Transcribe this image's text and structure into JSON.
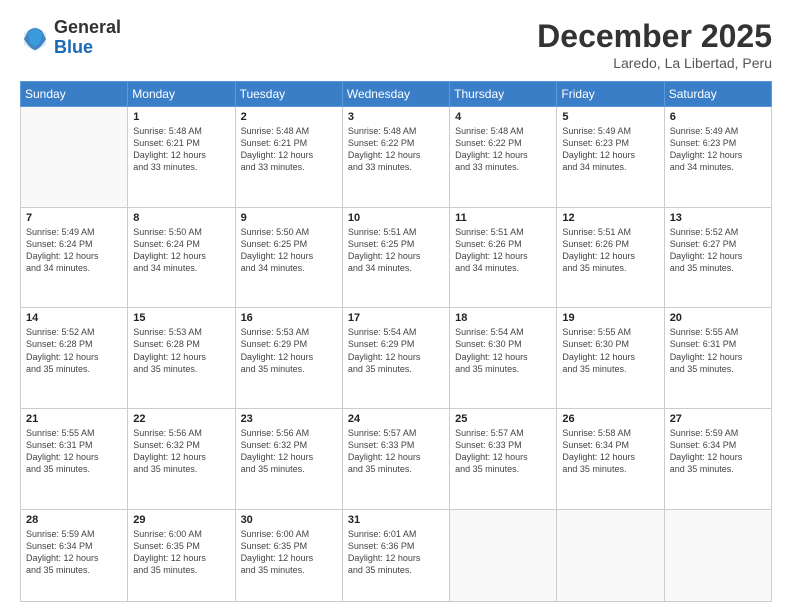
{
  "header": {
    "logo_general": "General",
    "logo_blue": "Blue",
    "month_title": "December 2025",
    "location": "Laredo, La Libertad, Peru"
  },
  "days_of_week": [
    "Sunday",
    "Monday",
    "Tuesday",
    "Wednesday",
    "Thursday",
    "Friday",
    "Saturday"
  ],
  "weeks": [
    [
      {
        "day": "",
        "info": ""
      },
      {
        "day": "1",
        "info": "Sunrise: 5:48 AM\nSunset: 6:21 PM\nDaylight: 12 hours\nand 33 minutes."
      },
      {
        "day": "2",
        "info": "Sunrise: 5:48 AM\nSunset: 6:21 PM\nDaylight: 12 hours\nand 33 minutes."
      },
      {
        "day": "3",
        "info": "Sunrise: 5:48 AM\nSunset: 6:22 PM\nDaylight: 12 hours\nand 33 minutes."
      },
      {
        "day": "4",
        "info": "Sunrise: 5:48 AM\nSunset: 6:22 PM\nDaylight: 12 hours\nand 33 minutes."
      },
      {
        "day": "5",
        "info": "Sunrise: 5:49 AM\nSunset: 6:23 PM\nDaylight: 12 hours\nand 34 minutes."
      },
      {
        "day": "6",
        "info": "Sunrise: 5:49 AM\nSunset: 6:23 PM\nDaylight: 12 hours\nand 34 minutes."
      }
    ],
    [
      {
        "day": "7",
        "info": "Sunrise: 5:49 AM\nSunset: 6:24 PM\nDaylight: 12 hours\nand 34 minutes."
      },
      {
        "day": "8",
        "info": "Sunrise: 5:50 AM\nSunset: 6:24 PM\nDaylight: 12 hours\nand 34 minutes."
      },
      {
        "day": "9",
        "info": "Sunrise: 5:50 AM\nSunset: 6:25 PM\nDaylight: 12 hours\nand 34 minutes."
      },
      {
        "day": "10",
        "info": "Sunrise: 5:51 AM\nSunset: 6:25 PM\nDaylight: 12 hours\nand 34 minutes."
      },
      {
        "day": "11",
        "info": "Sunrise: 5:51 AM\nSunset: 6:26 PM\nDaylight: 12 hours\nand 34 minutes."
      },
      {
        "day": "12",
        "info": "Sunrise: 5:51 AM\nSunset: 6:26 PM\nDaylight: 12 hours\nand 35 minutes."
      },
      {
        "day": "13",
        "info": "Sunrise: 5:52 AM\nSunset: 6:27 PM\nDaylight: 12 hours\nand 35 minutes."
      }
    ],
    [
      {
        "day": "14",
        "info": "Sunrise: 5:52 AM\nSunset: 6:28 PM\nDaylight: 12 hours\nand 35 minutes."
      },
      {
        "day": "15",
        "info": "Sunrise: 5:53 AM\nSunset: 6:28 PM\nDaylight: 12 hours\nand 35 minutes."
      },
      {
        "day": "16",
        "info": "Sunrise: 5:53 AM\nSunset: 6:29 PM\nDaylight: 12 hours\nand 35 minutes."
      },
      {
        "day": "17",
        "info": "Sunrise: 5:54 AM\nSunset: 6:29 PM\nDaylight: 12 hours\nand 35 minutes."
      },
      {
        "day": "18",
        "info": "Sunrise: 5:54 AM\nSunset: 6:30 PM\nDaylight: 12 hours\nand 35 minutes."
      },
      {
        "day": "19",
        "info": "Sunrise: 5:55 AM\nSunset: 6:30 PM\nDaylight: 12 hours\nand 35 minutes."
      },
      {
        "day": "20",
        "info": "Sunrise: 5:55 AM\nSunset: 6:31 PM\nDaylight: 12 hours\nand 35 minutes."
      }
    ],
    [
      {
        "day": "21",
        "info": "Sunrise: 5:55 AM\nSunset: 6:31 PM\nDaylight: 12 hours\nand 35 minutes."
      },
      {
        "day": "22",
        "info": "Sunrise: 5:56 AM\nSunset: 6:32 PM\nDaylight: 12 hours\nand 35 minutes."
      },
      {
        "day": "23",
        "info": "Sunrise: 5:56 AM\nSunset: 6:32 PM\nDaylight: 12 hours\nand 35 minutes."
      },
      {
        "day": "24",
        "info": "Sunrise: 5:57 AM\nSunset: 6:33 PM\nDaylight: 12 hours\nand 35 minutes."
      },
      {
        "day": "25",
        "info": "Sunrise: 5:57 AM\nSunset: 6:33 PM\nDaylight: 12 hours\nand 35 minutes."
      },
      {
        "day": "26",
        "info": "Sunrise: 5:58 AM\nSunset: 6:34 PM\nDaylight: 12 hours\nand 35 minutes."
      },
      {
        "day": "27",
        "info": "Sunrise: 5:59 AM\nSunset: 6:34 PM\nDaylight: 12 hours\nand 35 minutes."
      }
    ],
    [
      {
        "day": "28",
        "info": "Sunrise: 5:59 AM\nSunset: 6:34 PM\nDaylight: 12 hours\nand 35 minutes."
      },
      {
        "day": "29",
        "info": "Sunrise: 6:00 AM\nSunset: 6:35 PM\nDaylight: 12 hours\nand 35 minutes."
      },
      {
        "day": "30",
        "info": "Sunrise: 6:00 AM\nSunset: 6:35 PM\nDaylight: 12 hours\nand 35 minutes."
      },
      {
        "day": "31",
        "info": "Sunrise: 6:01 AM\nSunset: 6:36 PM\nDaylight: 12 hours\nand 35 minutes."
      },
      {
        "day": "",
        "info": ""
      },
      {
        "day": "",
        "info": ""
      },
      {
        "day": "",
        "info": ""
      }
    ]
  ]
}
